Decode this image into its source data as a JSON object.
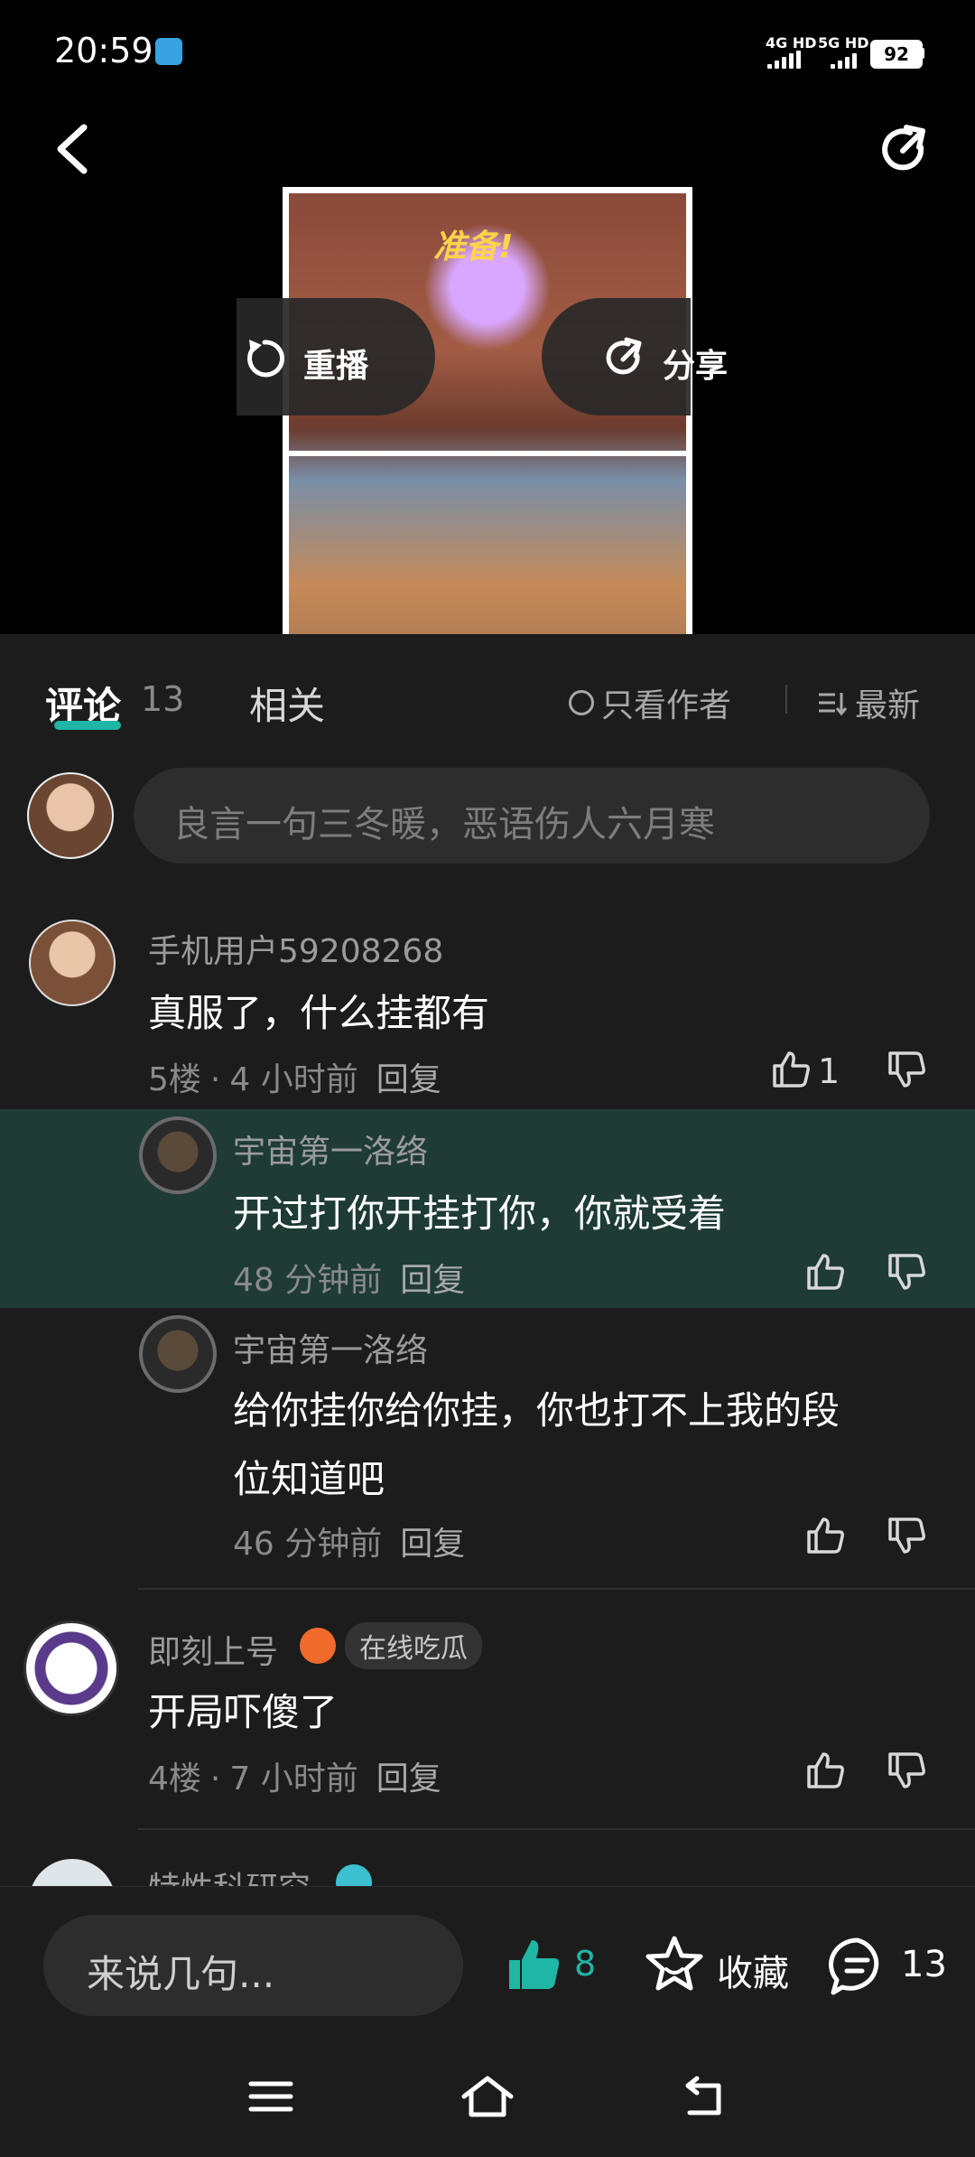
{
  "status_bar": {
    "time": "20:59",
    "net1": "4G HD",
    "net2": "5G HD",
    "battery": "92"
  },
  "video": {
    "title": "准备!",
    "replay_label": "重播",
    "share_label": "分享"
  },
  "tabs": {
    "comments_label": "评论",
    "comments_count": "13",
    "related_label": "相关",
    "author_only_label": "只看作者",
    "sort_label": "最新"
  },
  "comment_input": {
    "placeholder": "良言一句三冬暖，恶语伤人六月寒"
  },
  "comments": [
    {
      "username": "手机用户59208268",
      "text": "真服了，什么挂都有",
      "floor": "5楼",
      "time": "4 小时前",
      "reply": "回复",
      "likes": "1"
    },
    {
      "username": "宇宙第一洛络",
      "text": "开过打你开挂打你，你就受着",
      "time": "48 分钟前",
      "reply": "回复"
    },
    {
      "username": "宇宙第一洛络",
      "text_line1": "给你挂你给你挂，你也打不上我的段",
      "text_line2": "位知道吧",
      "time": "46 分钟前",
      "reply": "回复"
    },
    {
      "username": "即刻上号",
      "badge": "在线吃瓜",
      "text": "开局吓傻了",
      "floor": "4楼",
      "time": "7 小时前",
      "reply": "回复"
    },
    {
      "username": "特性科研究"
    }
  ],
  "bottom_bar": {
    "input_placeholder": "来说几句...",
    "like_count": "8",
    "favorite_label": "收藏",
    "comment_count": "13"
  },
  "colors": {
    "accent": "#1fb6a6",
    "background": "#1c1c1c",
    "highlight_row": "#1e3b36"
  }
}
